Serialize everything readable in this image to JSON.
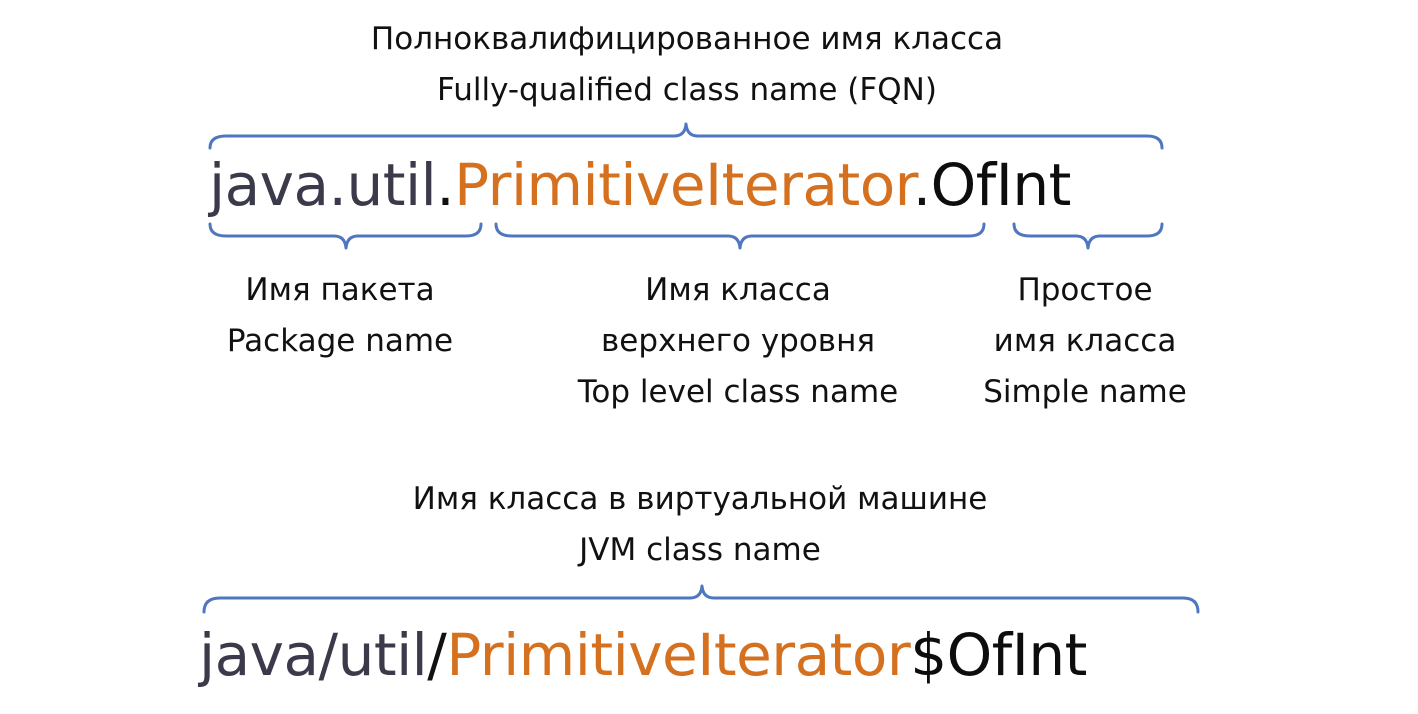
{
  "fqn": {
    "title_ru": "Полноквалифицированное имя класса",
    "title_en": "Fully-qualified class name (FQN)",
    "package": "java.util",
    "sep1": ".",
    "top_level": "PrimitiveIterator",
    "sep2": ".",
    "simple": "OfInt"
  },
  "parts": {
    "package": {
      "ru": "Имя пакета",
      "en": "Package name"
    },
    "top_level": {
      "ru_1": "Имя класса",
      "ru_2": "верхнего уровня",
      "en": "Top level class name"
    },
    "simple": {
      "ru_1": "Простое",
      "ru_2": "имя класса",
      "en": "Simple name"
    }
  },
  "jvm": {
    "title_ru": "Имя класса в виртуальной машине",
    "title_en": "JVM class name",
    "package": "java/util",
    "sep1": "/",
    "top_level": "PrimitiveIterator",
    "sep2": "$",
    "simple": "OfInt"
  },
  "colors": {
    "package": "#3a3a4a",
    "top_level": "#d5701f",
    "simple": "#0d0d0d",
    "brace": "#4f76c0"
  }
}
